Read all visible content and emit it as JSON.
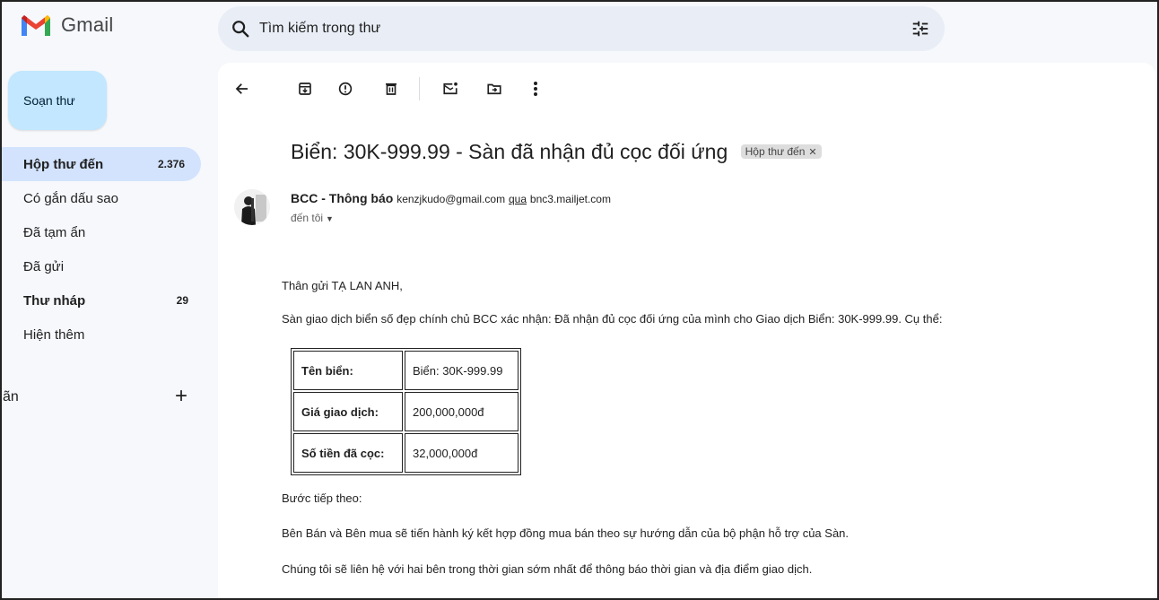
{
  "app": {
    "name": "Gmail"
  },
  "search": {
    "placeholder": "Tìm kiếm trong thư"
  },
  "compose": {
    "label": "Soạn thư"
  },
  "sidebar": {
    "items": [
      {
        "label": "Hộp thư đến",
        "count": "2.376"
      },
      {
        "label": "Có gắn dấu sao",
        "count": ""
      },
      {
        "label": "Đã tạm ẩn",
        "count": ""
      },
      {
        "label": "Đã gửi",
        "count": ""
      },
      {
        "label": "Thư nháp",
        "count": "29"
      },
      {
        "label": "Hiện thêm",
        "count": ""
      }
    ],
    "labels_heading": "ãn"
  },
  "toolbar": {
    "icons": [
      "back-arrow-icon",
      "archive-icon",
      "report-spam-icon",
      "delete-icon",
      "mark-unread-icon",
      "move-to-icon",
      "more-vert-icon"
    ]
  },
  "email": {
    "subject": "Biển: 30K-999.99 - Sàn đã nhận đủ cọc đối ứng",
    "label_chip": "Hộp thư đến",
    "sender_name": "BCC - Thông báo",
    "sender_email": "kenzjkudo@gmail.com",
    "via_text": "qua",
    "via_host": "bnc3.mailjet.com",
    "to_text": "đến tôi",
    "greeting": "Thân gửi TẠ LAN ANH,",
    "intro": "Sàn giao dịch biển số đẹp chính chủ BCC xác nhận: Đã nhận đủ cọc đối ứng của mình cho Giao dịch Biển: 30K-999.99. Cụ thể:",
    "table": [
      {
        "key": "Tên biển:",
        "value": "Biển: 30K-999.99"
      },
      {
        "key": "Giá giao dịch:",
        "value": "200,000,000đ"
      },
      {
        "key": "Số tiền đã cọc:",
        "value": "32,000,000đ"
      }
    ],
    "next_step_heading": "Bước tiếp theo:",
    "next_step_1": "Bên Bán và Bên mua sẽ tiến hành ký kết hợp đồng mua bán theo sự hướng dẫn của bộ phận hỗ trợ của Sàn.",
    "next_step_2": "Chúng tôi sẽ liên hệ với hai bên trong thời gian sớm nhất để thông báo thời gian và địa điểm giao dịch."
  }
}
